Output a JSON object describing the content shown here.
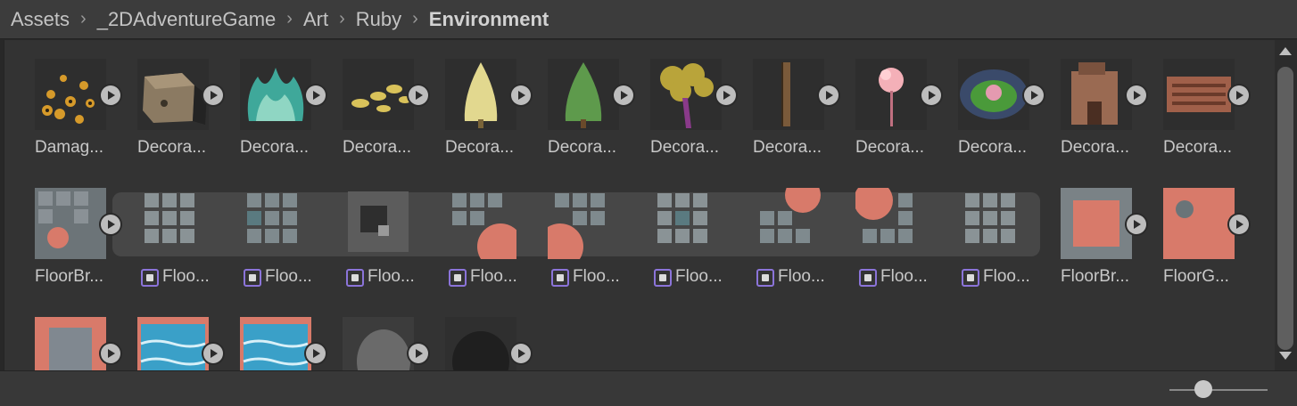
{
  "breadcrumb": [
    "Assets",
    "_2DAdventureGame",
    "Art",
    "Ruby",
    "Environment"
  ],
  "row1": [
    "Damag...",
    "Decora...",
    "Decora...",
    "Decora...",
    "Decora...",
    "Decora...",
    "Decora...",
    "Decora...",
    "Decora...",
    "Decora...",
    "Decora...",
    "Decora..."
  ],
  "row2": {
    "first": "FloorBr...",
    "subs": [
      "Floo...",
      "Floo...",
      "Floo...",
      "Floo...",
      "Floo...",
      "Floo...",
      "Floo...",
      "Floo...",
      "Floo..."
    ],
    "after": [
      "FloorBr...",
      "FloorG..."
    ]
  },
  "colors": {
    "sub_asset_icon": "#8b74d9",
    "panel": "#333333",
    "header": "#3c3c3c"
  },
  "icons": [
    "play-icon",
    "sprite-icon",
    "scroll-up-icon",
    "scroll-down-icon"
  ]
}
